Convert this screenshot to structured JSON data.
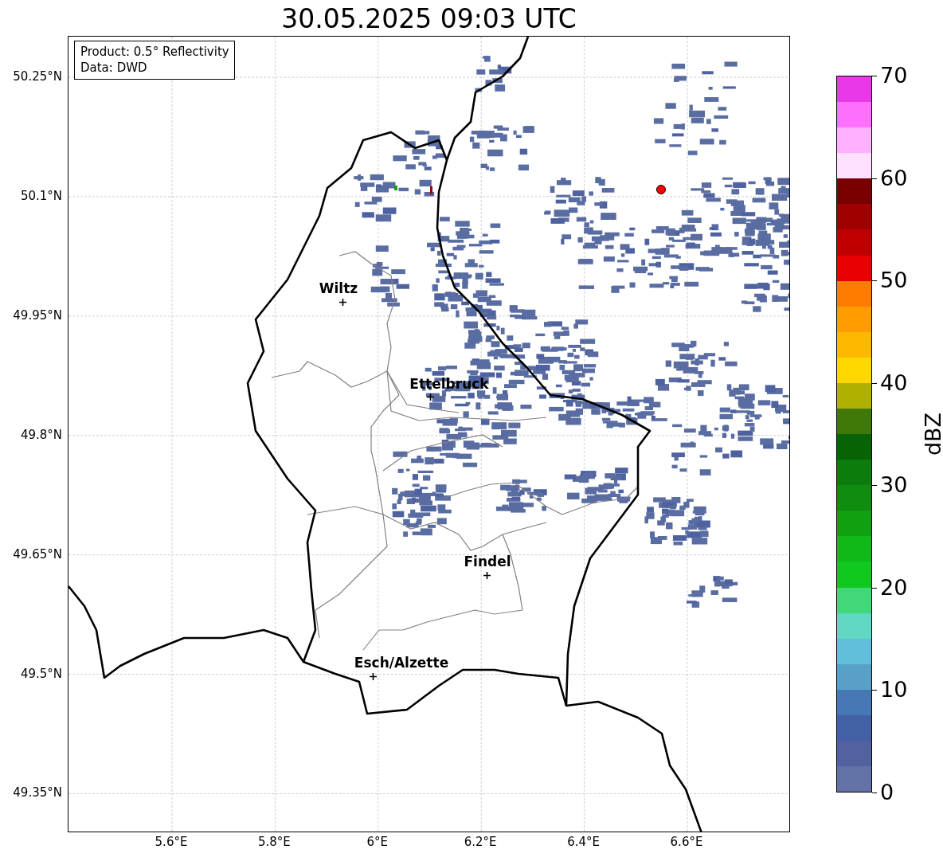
{
  "title": "30.05.2025 09:03 UTC",
  "info_box": [
    "Product: 0.5° Reflectivity",
    "Data: DWD"
  ],
  "cities": [
    {
      "name": "Wiltz"
    },
    {
      "name": "Ettelbruck"
    },
    {
      "name": "Findel"
    },
    {
      "name": "Esch/Alzette"
    }
  ],
  "y_ticks": [
    "50.25°N",
    "50.1°N",
    "49.95°N",
    "49.8°N",
    "49.65°N",
    "49.5°N",
    "49.35°N"
  ],
  "x_ticks": [
    "5.6°E",
    "5.8°E",
    "6°E",
    "6.2°E",
    "6.4°E",
    "6.6°E"
  ],
  "colorbar": {
    "label": "dBZ",
    "ticks": [
      "70",
      "60",
      "50",
      "40",
      "30",
      "20",
      "10",
      "0"
    ],
    "segments": [
      {
        "color": "#e838e8"
      },
      {
        "color": "#ff70ff"
      },
      {
        "color": "#ffb0ff"
      },
      {
        "color": "#ffe0ff"
      },
      {
        "color": "#780000"
      },
      {
        "color": "#a00000"
      },
      {
        "color": "#c00000"
      },
      {
        "color": "#e80000"
      },
      {
        "color": "#ff7c00"
      },
      {
        "color": "#ff9c00"
      },
      {
        "color": "#ffb800"
      },
      {
        "color": "#ffd800"
      },
      {
        "color": "#b0b000"
      },
      {
        "color": "#407808"
      },
      {
        "color": "#066406"
      },
      {
        "color": "#0c7c0c"
      },
      {
        "color": "#108c10"
      },
      {
        "color": "#10a010"
      },
      {
        "color": "#10b818"
      },
      {
        "color": "#10c820"
      },
      {
        "color": "#40d878"
      },
      {
        "color": "#60d8c4"
      },
      {
        "color": "#60c0dc"
      },
      {
        "color": "#58a0c8"
      },
      {
        "color": "#4878b4"
      },
      {
        "color": "#4460a4"
      },
      {
        "color": "#5262a0"
      },
      {
        "color": "#6272a6"
      }
    ]
  }
}
